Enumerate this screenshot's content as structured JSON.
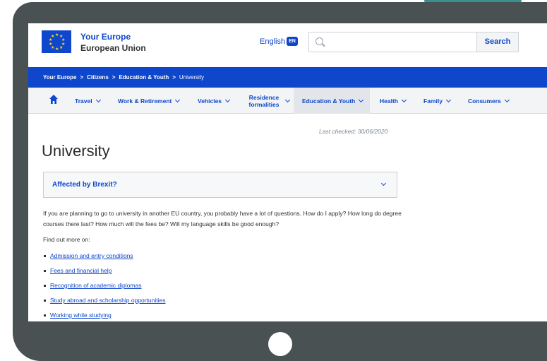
{
  "site": {
    "brand_line1": "Your Europe",
    "brand_line2": "European Union",
    "language": "English",
    "language_code": "EN",
    "search_placeholder": "",
    "search_button": "Search"
  },
  "breadcrumb": [
    "Your Europe",
    "Citizens",
    "Education & Youth",
    "University"
  ],
  "breadcrumb_separator": ">",
  "nav": {
    "items": [
      "Travel",
      "Work & Retirement",
      "Vehicles",
      "Residence formalities",
      "Education & Youth",
      "Health",
      "Family",
      "Consumers"
    ],
    "active": "Education & Youth"
  },
  "page": {
    "last_checked": "Last checked: 30/06/2020",
    "title": "University",
    "accordion_label": "Affected by Brexit?",
    "intro": "If you are planning to go to university in another EU country, you probably have a lot of questions. How do I apply? How long do degree courses there last? How much will the fees be? Will my language skills be good enough?",
    "find_out_more": "Find out more on:",
    "links": [
      "Admission and entry conditions",
      "Fees and financial help",
      "Recognition of academic diplomas",
      "Study abroad and scholarship opportunities",
      "Working while studying"
    ]
  },
  "colors": {
    "eu_blue": "#0e47cb",
    "eu_yellow": "#ffd617",
    "tablet_frame": "#4a5152",
    "accent_tab": "#3a8f8f"
  },
  "icons": [
    "eu-flag-icon",
    "language-icon",
    "search-icon",
    "home-icon",
    "chevron-down-icon"
  ]
}
